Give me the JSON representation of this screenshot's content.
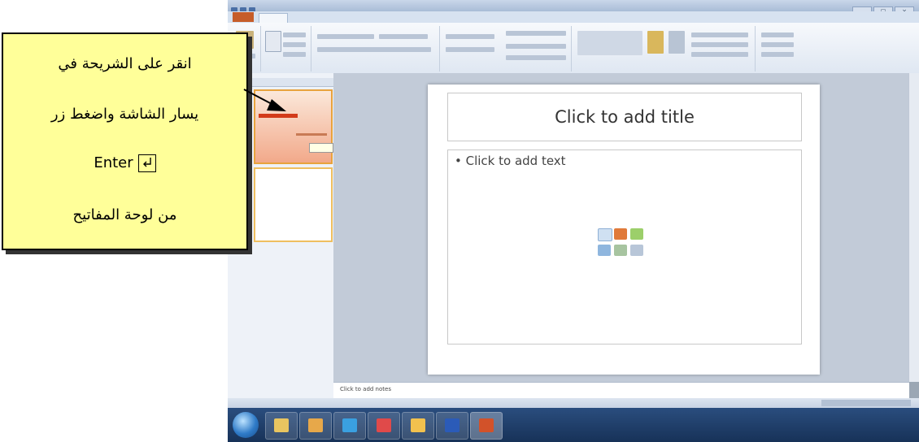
{
  "callout": {
    "line1": "انقر على الشريحة في",
    "line2": "يسار الشاشة واضغط زر",
    "line3": "Enter",
    "line4": "من لوحة المفاتيح"
  },
  "slide": {
    "title_placeholder": "Click to add title",
    "body_placeholder": "• Click to add text"
  },
  "notes": {
    "placeholder": "Click to add notes"
  },
  "colors": {
    "callout_bg": "#ffff99",
    "file_tab": "#c65d2a",
    "taskbar": "#1f3c66"
  },
  "icons": [
    "enter-key-icon",
    "chart-icon",
    "table-icon",
    "picture-icon",
    "smartart-icon",
    "media-icon",
    "clipart-icon"
  ]
}
